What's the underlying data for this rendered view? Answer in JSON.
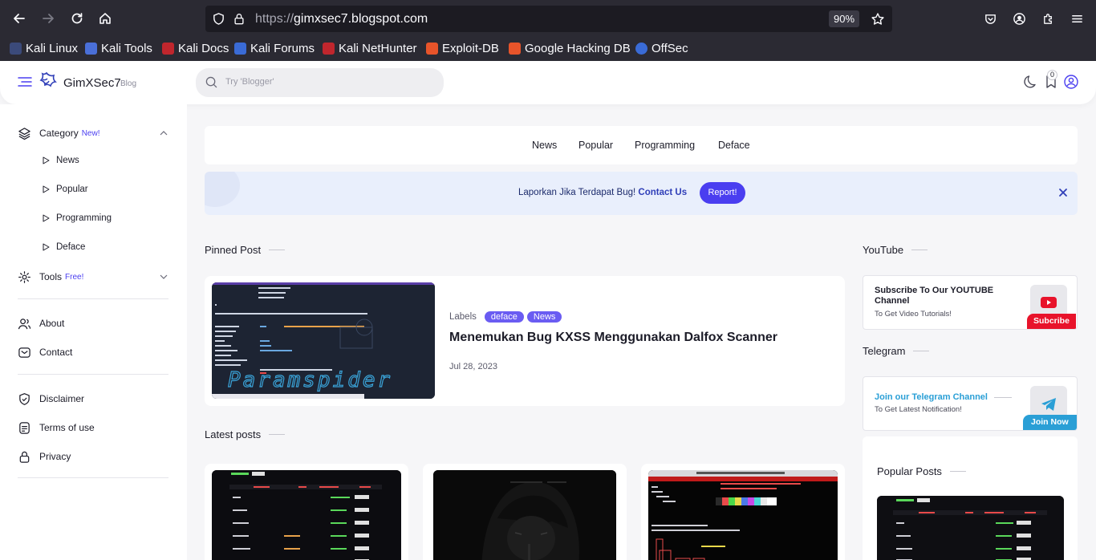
{
  "browser": {
    "url_protocol": "https://",
    "url_host": "gimxsec7.blogspot.com",
    "zoom": "90%",
    "bookmarks": [
      {
        "label": "Kali Linux",
        "color": "#3b4a7a"
      },
      {
        "label": "Kali Tools",
        "color": "#4a6fd8"
      },
      {
        "label": "Kali Docs",
        "color": "#c0262d"
      },
      {
        "label": "Kali Forums",
        "color": "#3a6bd6"
      },
      {
        "label": "Kali NetHunter",
        "color": "#c0262d"
      },
      {
        "label": "Exploit-DB",
        "color": "#e8542a"
      },
      {
        "label": "Google Hacking DB",
        "color": "#e8542a"
      },
      {
        "label": "OffSec",
        "color": "#3a6bd6"
      }
    ]
  },
  "header": {
    "brand": "GimXSec7",
    "brand_sub": "Blog",
    "search_placeholder": "Try 'Blogger'",
    "bookmark_count": "0"
  },
  "sidebar": {
    "category_label": "Category",
    "category_tag": "New!",
    "categories": [
      "News",
      "Popular",
      "Programming",
      "Deface"
    ],
    "tools_label": "Tools",
    "tools_tag": "Free!",
    "about": "About",
    "contact": "Contact",
    "disclaimer": "Disclaimer",
    "terms": "Terms of use",
    "privacy": "Privacy"
  },
  "main": {
    "nav": [
      "News",
      "Popular",
      "Programming",
      "Deface"
    ],
    "notice_text": "Laporkan Jika Terdapat Bug!",
    "notice_link": "Contact Us",
    "notice_button": "Report!",
    "pinned_title": "Pinned Post",
    "pinned": {
      "labels_prefix": "Labels",
      "labels": [
        "deface",
        "News"
      ],
      "title": "Menemukan Bug KXSS Menggunakan Dalfox Scanner",
      "date": "Jul 28, 2023"
    },
    "latest_title": "Latest posts"
  },
  "right": {
    "youtube_title": "YouTube",
    "youtube_widget_title": "Subscribe To Our YOUTUBE Channel",
    "youtube_widget_sub": "To Get Video Tutorials!",
    "youtube_button": "Subcribe",
    "telegram_title": "Telegram",
    "telegram_widget_title": "Join our Telegram Channel",
    "telegram_widget_sub": "To Get Latest Notification!",
    "telegram_button": "Join Now",
    "popular_title": "Popular Posts"
  },
  "colors": {
    "accent": "#4a3ef0",
    "youtube_red": "#e8132b",
    "telegram_blue": "#2a9fd6"
  }
}
